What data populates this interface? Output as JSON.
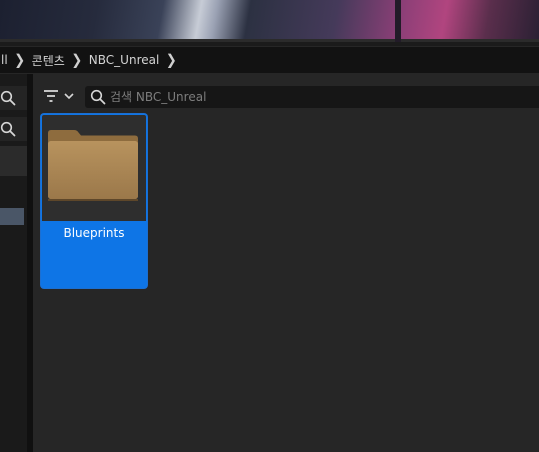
{
  "breadcrumb": {
    "items": [
      "ll",
      "콘텐츠",
      "NBC_Unreal"
    ]
  },
  "content_browser": {
    "search": {
      "placeholder": "검색 NBC_Unreal",
      "value": ""
    },
    "assets": [
      {
        "label": "Blueprints",
        "type": "folder",
        "selected": true
      }
    ]
  },
  "icons": {
    "breadcrumb_separator": "chevron-right-icon",
    "filter": "filter-icon",
    "filter_dropdown": "chevron-down-icon",
    "search": "search-icon",
    "asset_thumbnail": "folder-icon"
  },
  "colors": {
    "selection": "#0e75e6",
    "folder": "#b08b57",
    "panel_background": "#262626",
    "breadcrumb_background": "#121212"
  }
}
